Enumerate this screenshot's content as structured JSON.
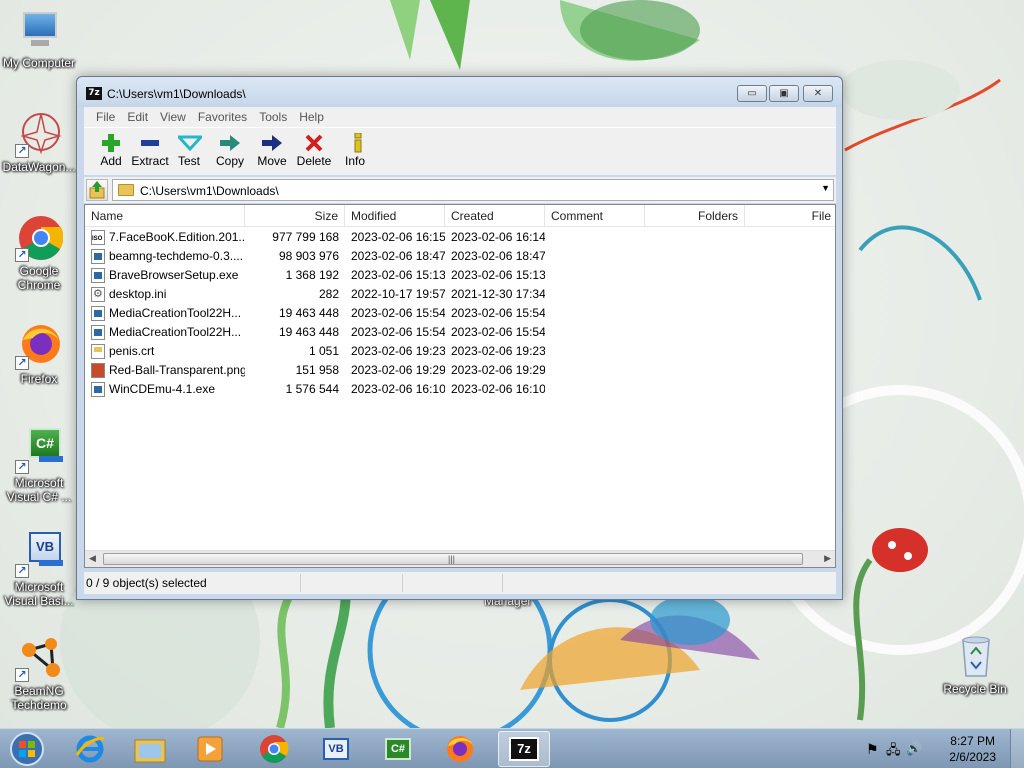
{
  "desktop": {
    "icons": [
      {
        "label": "My Computer",
        "icon": "computer-icon"
      },
      {
        "label": "DataWagon...",
        "icon": "datawagon-icon"
      },
      {
        "label": "Google Chrome",
        "icon": "chrome-icon"
      },
      {
        "label": "Firefox",
        "icon": "firefox-icon"
      },
      {
        "label": "Microsoft Visual C# ...",
        "icon": "visual-csharp-icon"
      },
      {
        "label": "Microsoft Visual Basi...",
        "icon": "visual-basic-icon"
      },
      {
        "label": "BeamNG Techdemo",
        "icon": "beamng-icon"
      },
      {
        "label": "Recycle Bin",
        "icon": "recycle-bin-icon"
      }
    ],
    "hidden_label": "Manager"
  },
  "window": {
    "title": "C:\\Users\\vm1\\Downloads\\",
    "app_icon": "7z",
    "caption_min": "▭",
    "caption_max": "▣",
    "caption_close": "✕",
    "menu": [
      "File",
      "Edit",
      "View",
      "Favorites",
      "Tools",
      "Help"
    ],
    "toolbar": [
      {
        "label": "Add",
        "icon": "plus-icon",
        "color": "#2aa52a"
      },
      {
        "label": "Extract",
        "icon": "minus-icon",
        "color": "#1f3f9e"
      },
      {
        "label": "Test",
        "icon": "check-icon",
        "color": "#26b6c9"
      },
      {
        "label": "Copy",
        "icon": "copy-arrow-icon",
        "color": "#2a8a7a"
      },
      {
        "label": "Move",
        "icon": "move-arrow-icon",
        "color": "#1f2f80"
      },
      {
        "label": "Delete",
        "icon": "delete-x-icon",
        "color": "#d21f1f"
      },
      {
        "label": "Info",
        "icon": "info-icon",
        "color": "#e2c01d"
      }
    ],
    "address": "C:\\Users\\vm1\\Downloads\\",
    "columns": [
      "Name",
      "Size",
      "Modified",
      "Created",
      "Comment",
      "Folders",
      "File"
    ],
    "files": [
      {
        "name": "7.FaceBooK.Edition.201...",
        "size": "977 799 168",
        "modified": "2023-02-06 16:15",
        "created": "2023-02-06 16:14",
        "type": "iso"
      },
      {
        "name": "beamng-techdemo-0.3....",
        "size": "98 903 976",
        "modified": "2023-02-06 18:47",
        "created": "2023-02-06 18:47",
        "type": "exe"
      },
      {
        "name": "BraveBrowserSetup.exe",
        "size": "1 368 192",
        "modified": "2023-02-06 15:13",
        "created": "2023-02-06 15:13",
        "type": "exe"
      },
      {
        "name": "desktop.ini",
        "size": "282",
        "modified": "2022-10-17 19:57",
        "created": "2021-12-30 17:34",
        "type": "ini"
      },
      {
        "name": "MediaCreationTool22H...",
        "size": "19 463 448",
        "modified": "2023-02-06 15:54",
        "created": "2023-02-06 15:54",
        "type": "exe"
      },
      {
        "name": "MediaCreationTool22H...",
        "size": "19 463 448",
        "modified": "2023-02-06 15:54",
        "created": "2023-02-06 15:54",
        "type": "exe"
      },
      {
        "name": "penis.crt",
        "size": "1 051",
        "modified": "2023-02-06 19:23",
        "created": "2023-02-06 19:23",
        "type": "crt"
      },
      {
        "name": "Red-Ball-Transparent.png",
        "size": "151 958",
        "modified": "2023-02-06 19:29",
        "created": "2023-02-06 19:29",
        "type": "png"
      },
      {
        "name": "WinCDEmu-4.1.exe",
        "size": "1 576 544",
        "modified": "2023-02-06 16:10",
        "created": "2023-02-06 16:10",
        "type": "exe"
      }
    ],
    "status": "0 / 9 object(s) selected"
  },
  "taskbar": {
    "items": [
      "internet-explorer-icon",
      "windows-explorer-icon",
      "media-player-icon",
      "chrome-icon",
      "visual-basic-icon",
      "visual-csharp-icon",
      "firefox-icon",
      "7zip-icon"
    ],
    "active_item": "7zip-icon",
    "clock_time": "8:27 PM",
    "clock_date": "2/6/2023"
  }
}
